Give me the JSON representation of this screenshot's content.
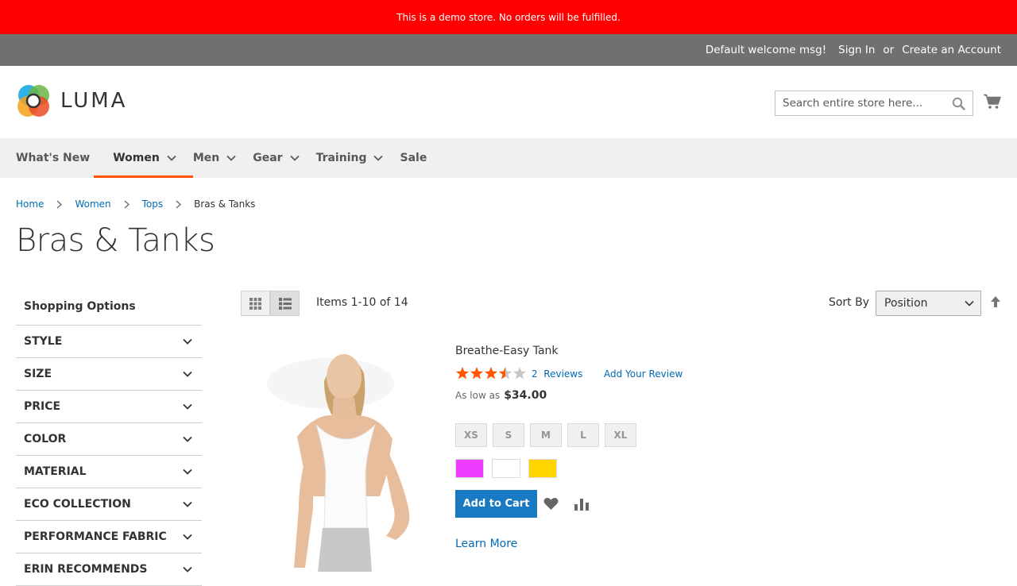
{
  "demo_notice": "This is a demo store. No orders will be fulfilled.",
  "header": {
    "welcome": "Default welcome msg!",
    "sign_in": "Sign In",
    "or": "or",
    "create_account": "Create an Account"
  },
  "logo": {
    "text": "LUMA"
  },
  "search": {
    "placeholder": "Search entire store here..."
  },
  "nav": {
    "items": [
      {
        "label": "What's New"
      },
      {
        "label": "Women"
      },
      {
        "label": "Men"
      },
      {
        "label": "Gear"
      },
      {
        "label": "Training"
      },
      {
        "label": "Sale"
      }
    ],
    "active": "Women"
  },
  "breadcrumbs": [
    "Home",
    "Women",
    "Tops",
    "Bras & Tanks"
  ],
  "page_title": "Bras & Tanks",
  "sidebar": {
    "title": "Shopping Options",
    "filters": [
      "STYLE",
      "SIZE",
      "PRICE",
      "COLOR",
      "MATERIAL",
      "ECO COLLECTION",
      "PERFORMANCE FABRIC",
      "ERIN RECOMMENDS"
    ]
  },
  "toolbar": {
    "amount": "Items 1-10 of 14",
    "sort_label": "Sort By",
    "sort_value": "Position",
    "view_mode": "list"
  },
  "product": {
    "name": "Breathe-Easy Tank",
    "rating_fraction": 0.7,
    "reviews_count": "2",
    "reviews_label": "Reviews",
    "add_review": "Add Your Review",
    "price_label": "As low as",
    "price": "$34.00",
    "sizes": [
      "XS",
      "S",
      "M",
      "L",
      "XL"
    ],
    "colors": [
      "#ef3dff",
      "#ffffff",
      "#ffd500"
    ],
    "add_to_cart": "Add to Cart",
    "learn_more": "Learn More"
  },
  "colors": {
    "demo_banner": "#ff0000",
    "header_bar": "#6e716e",
    "nav_bg": "#f0f0f0",
    "accent_underline": "#ff5501",
    "link": "#006bb4",
    "primary_button": "#1979c3",
    "star": "#ff5501"
  }
}
